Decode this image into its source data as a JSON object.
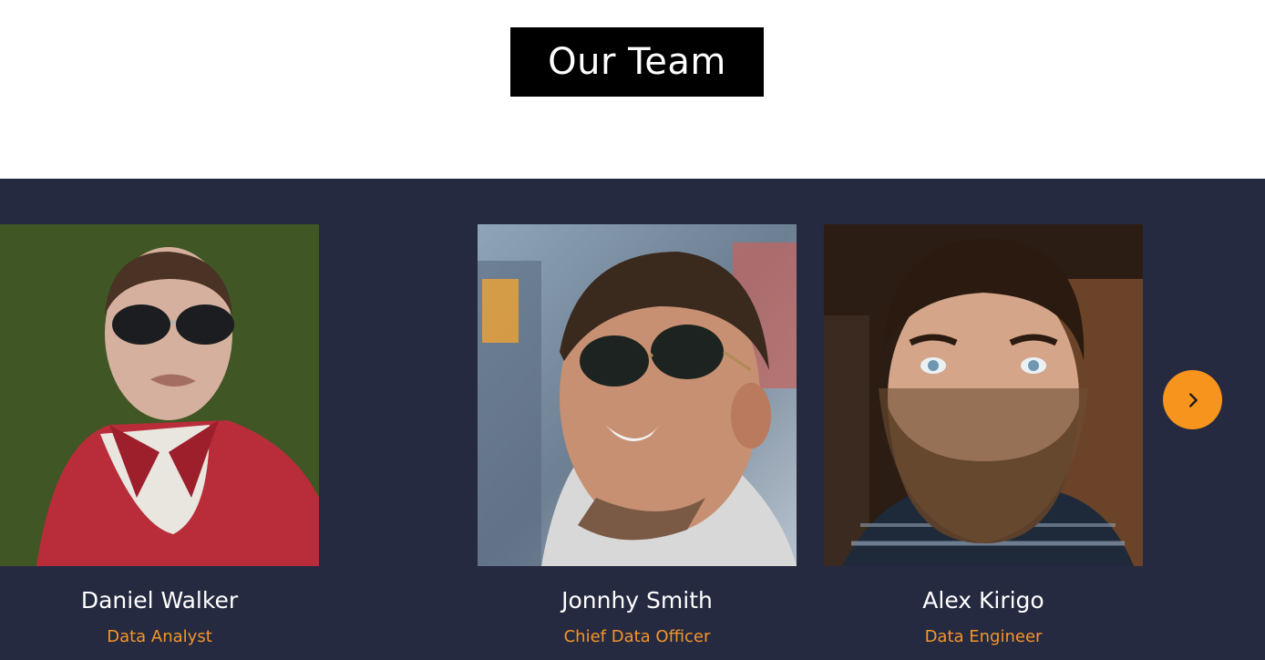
{
  "header": {
    "title": "Our Team"
  },
  "carousel": {
    "prev_icon": "chevron-left-icon",
    "next_icon": "chevron-right-icon",
    "accent_color": "#f7941d",
    "background_color": "#252a40"
  },
  "members": [
    {
      "name": "Jonnhy Smith",
      "role": "Chief Data Officer"
    },
    {
      "name": "Alex Kirigo",
      "role": "Data Engineer"
    },
    {
      "name": "Daniel Walker",
      "role": "Data Analyst"
    }
  ]
}
